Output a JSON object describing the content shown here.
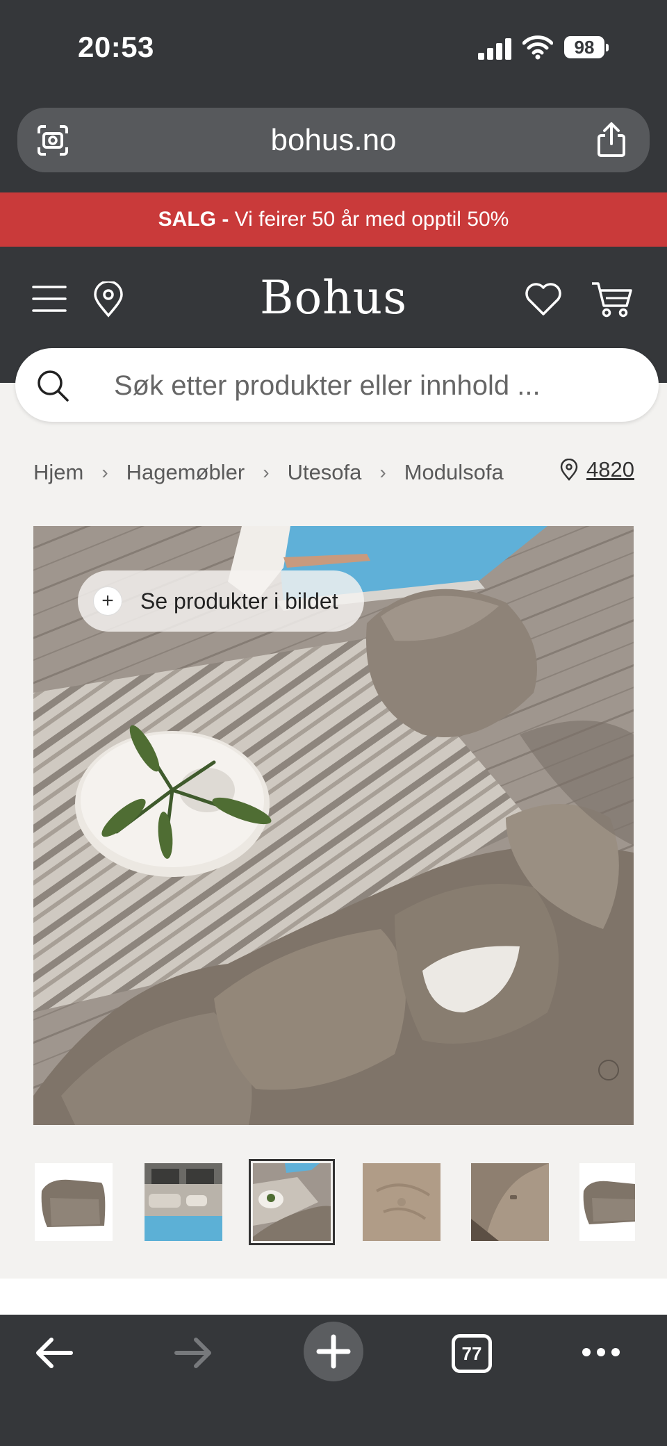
{
  "status_bar": {
    "time": "20:53",
    "battery": "98"
  },
  "browser": {
    "url": "bohus.no"
  },
  "sale_banner": {
    "bold": "SALG -",
    "text": " Vi feirer 50 år med opptil 50%"
  },
  "header": {
    "logo": "Bohus"
  },
  "search": {
    "placeholder": "Søk etter produkter eller innhold ..."
  },
  "breadcrumb": [
    "Hjem",
    "Hagemøbler",
    "Utesofa",
    "Modulsofa"
  ],
  "store": {
    "number": "4820"
  },
  "hero": {
    "see_products_label": "Se produkter i bildet",
    "plus": "+"
  },
  "thumbnails": {
    "count": 6,
    "selected_index": 2
  },
  "toolbar": {
    "tabs_count": "77"
  },
  "colors": {
    "dark": "#35373a",
    "sale_red": "#c93a3a",
    "background": "#f3f2f0"
  }
}
